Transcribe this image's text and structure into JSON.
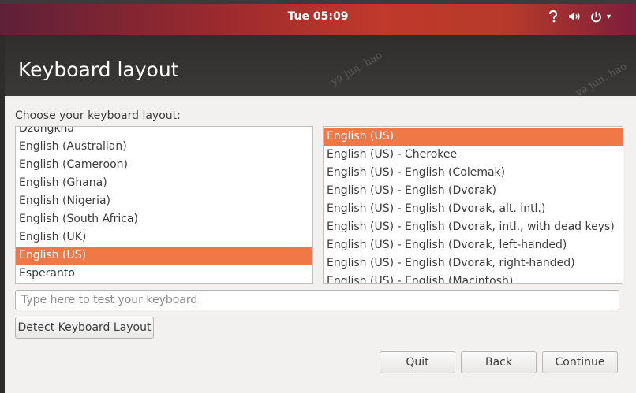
{
  "topbar": {
    "clock": "Tue 05:09",
    "icons": [
      "accessibility-icon",
      "volume-icon",
      "power-icon",
      "menu-caret-icon"
    ]
  },
  "window": {
    "title": "Keyboard layout",
    "watermark": "ya jun. hao"
  },
  "prompt": "Choose your keyboard layout:",
  "layouts": {
    "items": [
      "Dzongkha",
      "English (Australian)",
      "English (Cameroon)",
      "English (Ghana)",
      "English (Nigeria)",
      "English (South Africa)",
      "English (UK)",
      "English (US)",
      "Esperanto"
    ],
    "selected": "English (US)"
  },
  "variants": {
    "items": [
      "English (US)",
      "English (US) - Cherokee",
      "English (US) - English (Colemak)",
      "English (US) - English (Dvorak)",
      "English (US) - English (Dvorak, alt. intl.)",
      "English (US) - English (Dvorak, intl., with dead keys)",
      "English (US) - English (Dvorak, left-handed)",
      "English (US) - English (Dvorak, right-handed)",
      "English (US) - English (Macintosh)"
    ],
    "selected": "English (US)"
  },
  "test_field": {
    "value": "",
    "placeholder": "Type here to test your keyboard"
  },
  "buttons": {
    "detect": "Detect Keyboard Layout",
    "quit": "Quit",
    "back": "Back",
    "continue": "Continue"
  },
  "colors": {
    "accent": "#f07746",
    "header": "#2f2e2c"
  }
}
